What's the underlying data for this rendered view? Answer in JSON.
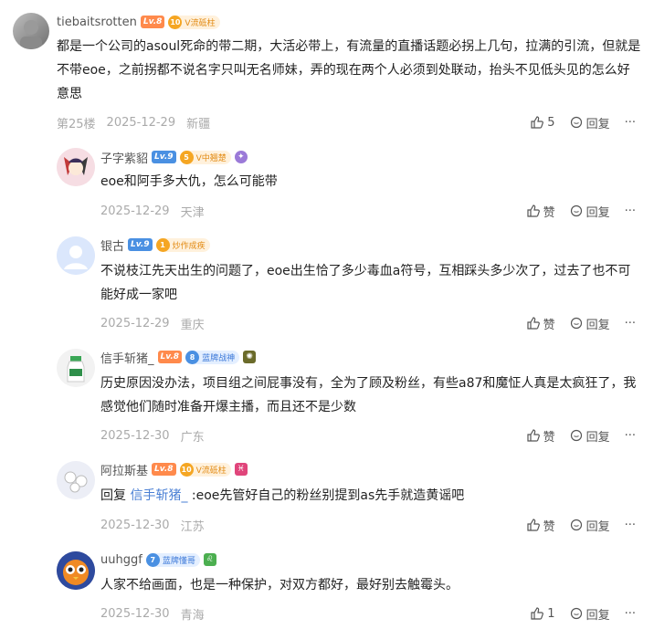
{
  "main_comment": {
    "user": "tiebaitsrotten",
    "level": "Lv.8",
    "badge_num": "10",
    "badge_text": "V流砥柱",
    "text": "都是一个公司的asoul死命的带二期，大活必带上，有流量的直播话题必拐上几句，拉满的引流，但就是不带eoe，之前拐都不说名字只叫无名师妹，弄的现在两个人必须到处联动，抬头不见低头见的怎么好意思",
    "floor": "第25楼",
    "date": "2025-12-29",
    "location": "新疆",
    "likes": "5",
    "reply_label": "回复",
    "more": "···"
  },
  "replies": [
    {
      "user": "子字紫貂",
      "level": "Lv.9",
      "badge_num": "5",
      "badge_text": "V中翘楚",
      "text": "eoe和阿手多大仇，怎么可能带",
      "date": "2025-12-29",
      "location": "天津",
      "like_label": "赞",
      "reply_label": "回复",
      "more": "···"
    },
    {
      "user": "银古",
      "level": "Lv.9",
      "badge_num": "1",
      "badge_text": "炒作成疾",
      "text": "不说枝江先天出生的问题了，eoe出生恰了多少毒血a符号，互相踩头多少次了，过去了也不可能好成一家吧",
      "date": "2025-12-29",
      "location": "重庆",
      "like_label": "赞",
      "reply_label": "回复",
      "more": "···"
    },
    {
      "user": "信手斩猪_",
      "level": "Lv.8",
      "badge_num": "8",
      "badge_text": "蓝牌战神",
      "text": "历史原因没办法，项目组之间屁事没有，全为了顾及粉丝，有些a87和魔怔人真是太疯狂了，我感觉他们随时准备开爆主播，而且还不是少数",
      "date": "2025-12-30",
      "location": "广东",
      "like_label": "赞",
      "reply_label": "回复",
      "more": "···"
    },
    {
      "user": "阿拉斯基",
      "level": "Lv.8",
      "badge_num": "10",
      "badge_text": "V流砥柱",
      "reply_prefix": "回复",
      "reply_target": "信手斩猪_",
      "text": ":eoe先管好自己的粉丝别提到as先手就造黄谣吧",
      "date": "2025-12-30",
      "location": "江苏",
      "like_label": "赞",
      "reply_label": "回复",
      "more": "···"
    },
    {
      "user": "uuhggf",
      "badge_num": "7",
      "badge_text": "蓝牌懂哥",
      "text": "人家不给画面，也是一种保护，对双方都好，最好别去触霉头。",
      "date": "2025-12-30",
      "location": "青海",
      "likes": "1",
      "reply_label": "回复",
      "more": "···"
    }
  ],
  "colors": {
    "reply_link": "#4a7fd4",
    "meta_text": "#aaaaaa",
    "lv8": "#ff8a4c",
    "lv9": "#4a90e2"
  }
}
